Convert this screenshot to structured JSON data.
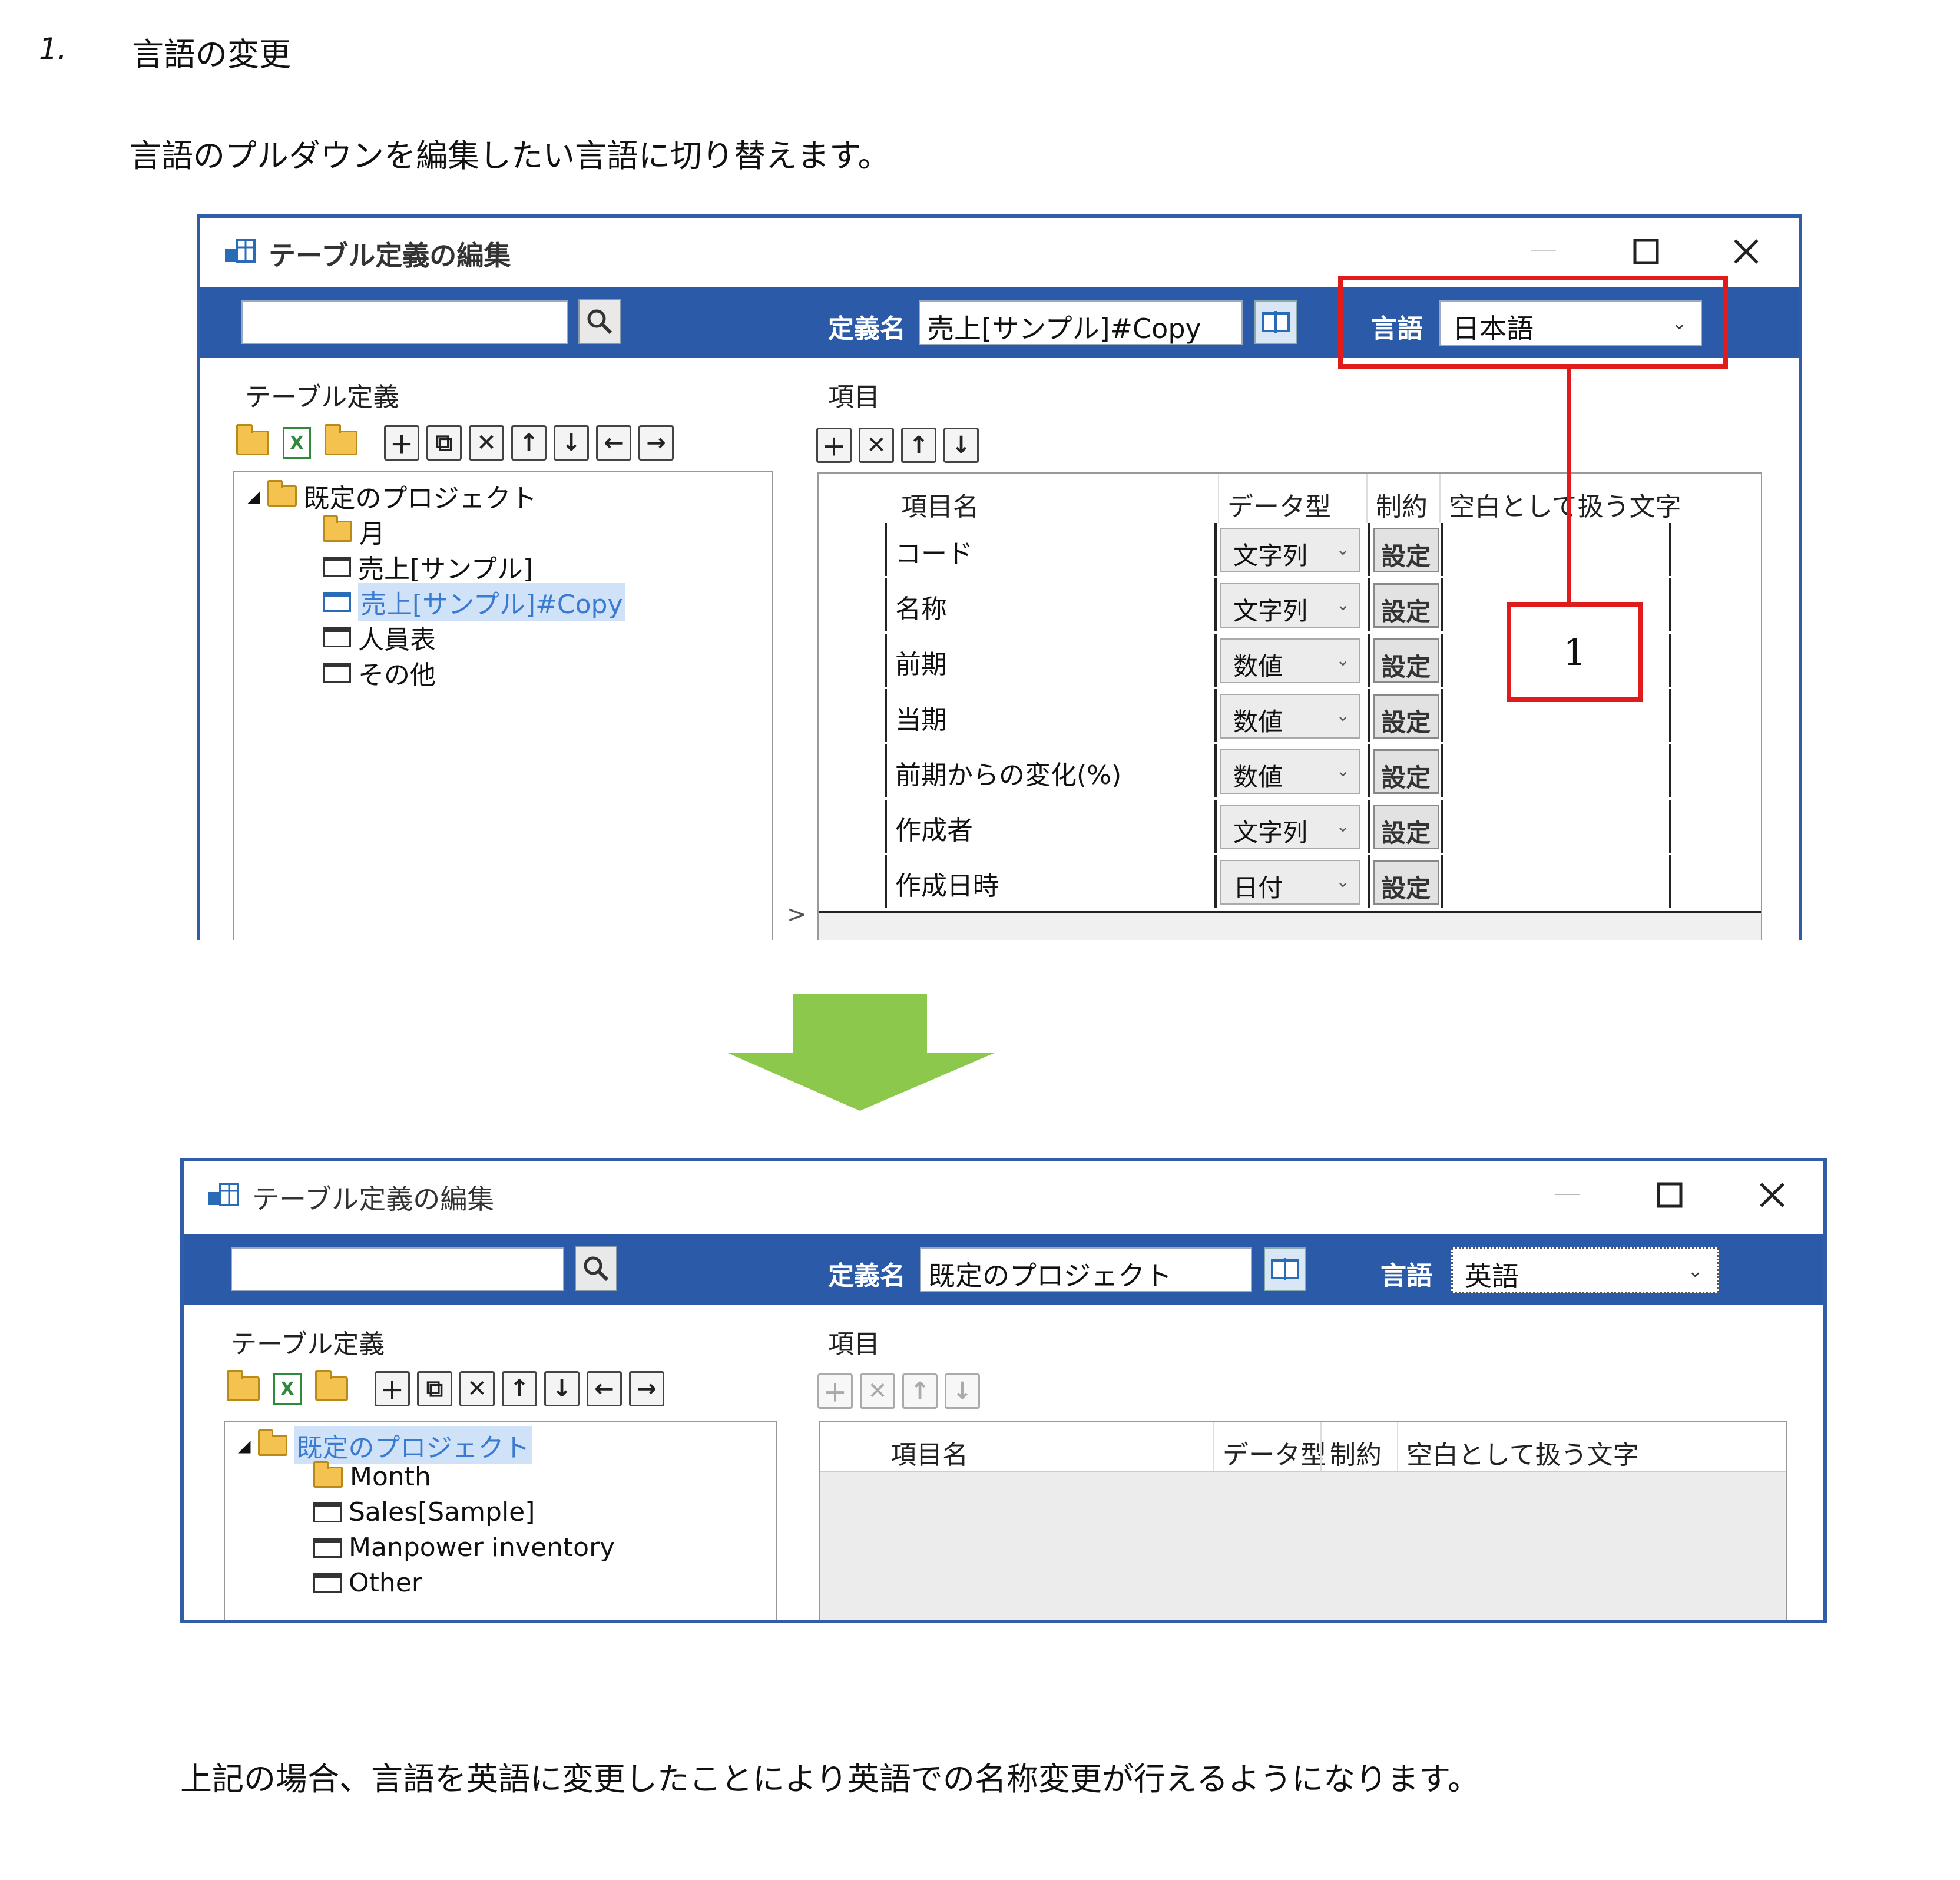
{
  "heading": {
    "number": "1.",
    "title": "言語の変更"
  },
  "intro_text": "言語のプルダウンを編集したい言語に切り替えます。",
  "footer_text": "上記の場合、言語を英語に変更したことにより英語での名称変更が行えるようになります。",
  "callout_label": "1",
  "colors": {
    "accent_bar": "#2a5aa8",
    "callout_red": "#e01b1b",
    "arrow_green": "#8cc84b"
  },
  "window1": {
    "title": "テーブル定義の編集",
    "minimize_icon": "minimize-icon",
    "maximize_icon": "maximize-icon",
    "close_icon": "close-icon",
    "definition_label": "定義名",
    "definition_value": "売上[サンプル]#Copy",
    "language_label": "言語",
    "language_value": "日本語",
    "table_def_label": "テーブル定義",
    "items_label": "項目",
    "tree": {
      "root": "既定のプロジェクト",
      "children": [
        "月",
        "売上[サンプル]",
        "売上[サンプル]#Copy",
        "人員表",
        "その他"
      ]
    },
    "grid": {
      "headers": [
        "項目名",
        "データ型",
        "制約",
        "空白として扱う文字"
      ],
      "rows": [
        {
          "name": "コード",
          "type": "文字列",
          "constraint": "設定"
        },
        {
          "name": "名称",
          "type": "文字列",
          "constraint": "設定"
        },
        {
          "name": "前期",
          "type": "数値",
          "constraint": "設定"
        },
        {
          "name": "当期",
          "type": "数値",
          "constraint": "設定"
        },
        {
          "name": "前期からの変化(%)",
          "type": "数値",
          "constraint": "設定"
        },
        {
          "name": "作成者",
          "type": "文字列",
          "constraint": "設定"
        },
        {
          "name": "作成日時",
          "type": "日付",
          "constraint": "設定"
        }
      ]
    },
    "splitter_glyph": ">"
  },
  "window2": {
    "title": "テーブル定義の編集",
    "definition_label": "定義名",
    "definition_value": "既定のプロジェクト",
    "language_label": "言語",
    "language_value": "英語",
    "table_def_label": "テーブル定義",
    "items_label": "項目",
    "tree": {
      "root": "既定のプロジェクト",
      "children": [
        "Month",
        "Sales[Sample]",
        "Manpower inventory",
        "Other"
      ]
    },
    "grid": {
      "headers": [
        "項目名",
        "データ型",
        "制約",
        "空白として扱う文字"
      ]
    }
  }
}
